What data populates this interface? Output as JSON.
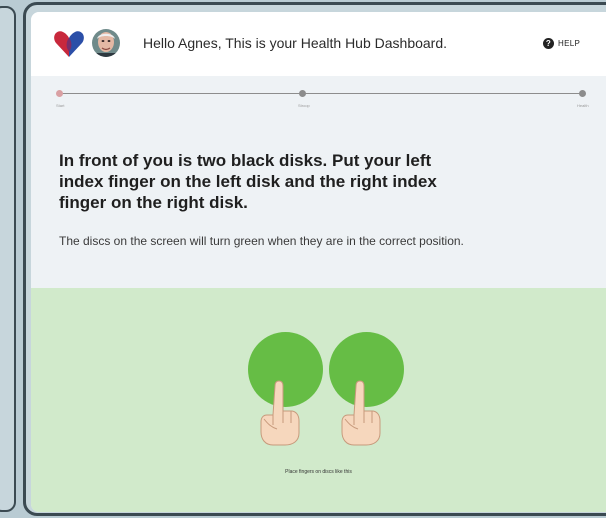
{
  "header": {
    "greeting": "Hello Agnes, This is your Health Hub Dashboard.",
    "help_label": "HELP",
    "help_icon": "question-mark-icon",
    "logo_icon": "heart-logo-icon",
    "logo_colors": [
      "#c8283c",
      "#2b4fa8"
    ]
  },
  "progress": {
    "steps": [
      {
        "label": "Start",
        "active": true
      },
      {
        "label": "Stroop",
        "active": false
      },
      {
        "label": "Health",
        "active": false
      }
    ]
  },
  "instructions": {
    "title": "In front of you is two black disks.  Put your left index finger on the left disk and the right index finger on the right disk.",
    "body": "The discs on the screen  will turn green when they are in the correct position."
  },
  "disks": {
    "color": "#66bd45",
    "caption": "Place fingers on discs like this"
  }
}
